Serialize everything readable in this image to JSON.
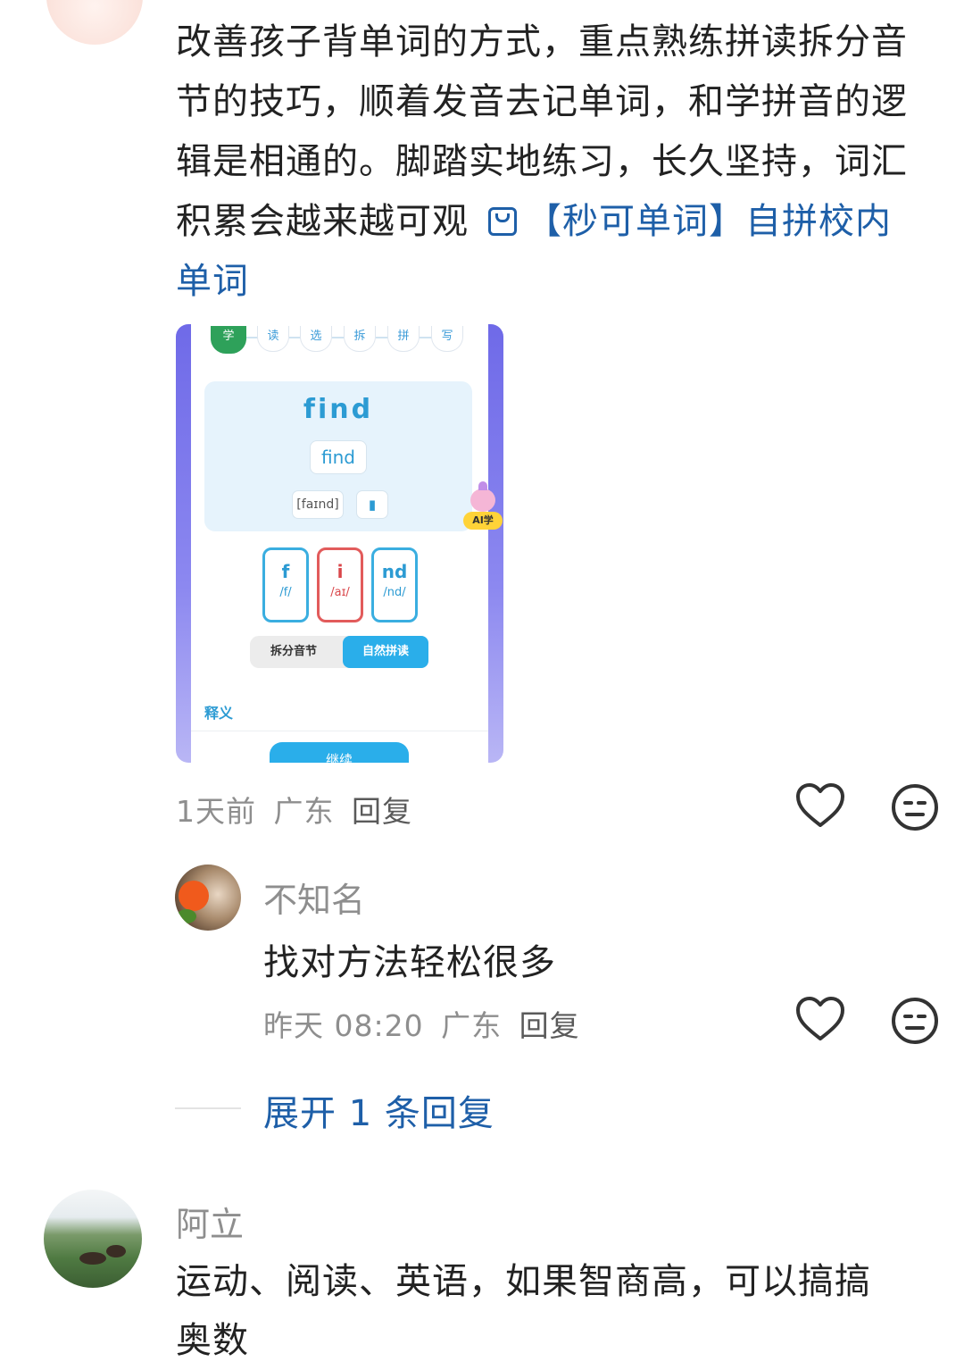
{
  "comments": {
    "top": {
      "text_plain": "改善孩子背单词的方式，重点熟练拼读拆分音节的技巧，顺着发音去记单词，和学拼音的逻辑是相通的。脚踏实地练习，长久坚持，词汇积累会越来越可观",
      "link_icon": "shopping-bag-icon",
      "link_text": "【秒可单词】自拼校内单词",
      "time": "1天前",
      "location": "广东",
      "reply_label": "回复"
    },
    "sub_reply": {
      "name": "不知名",
      "text": "找对方法轻松很多",
      "time": "昨天 08:20",
      "location": "广东",
      "reply_label": "回复"
    },
    "expand_label": "展开 1 条回复",
    "third": {
      "name": "阿立",
      "text": "运动、阅读、英语，如果智商高，可以搞搞奥数"
    }
  },
  "embedded_screenshot": {
    "steps": [
      "学",
      "读",
      "选",
      "拆",
      "拼",
      "写"
    ],
    "active_step": "学",
    "word": "find",
    "word_pill": "find",
    "phonetic": "[faɪnd]",
    "ai_badge": "AI学",
    "syllables": [
      {
        "letters": "f",
        "phonetic": "/f/",
        "color": "#3aaee0"
      },
      {
        "letters": "i",
        "phonetic": "/aɪ/",
        "color": "#e25b5b"
      },
      {
        "letters": "nd",
        "phonetic": "/nd/",
        "color": "#3aaee0"
      }
    ],
    "segment_left": "拆分音节",
    "segment_right": "自然拼读",
    "meaning_label": "释义",
    "continue_label": "继续"
  },
  "colors": {
    "link": "#1e5fa8",
    "meta_gray": "#8e8e8e",
    "accent_blue": "#2aaeea",
    "active_green": "#2ea15a"
  }
}
